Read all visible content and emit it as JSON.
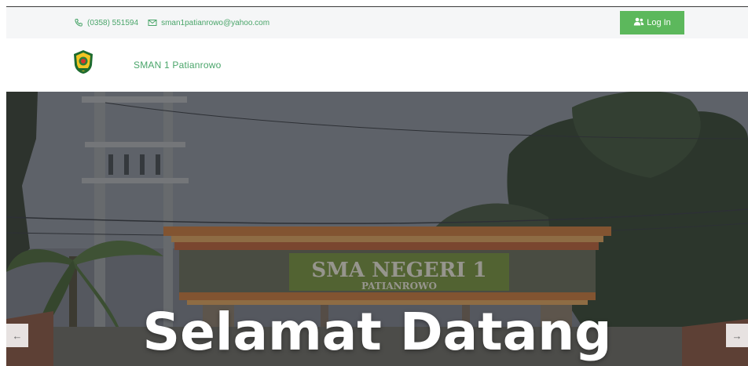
{
  "topbar": {
    "phone": "(0358) 551594",
    "email": "sman1patianrowo@yahoo.com",
    "login_label": "Log In"
  },
  "header": {
    "site_title": "SMAN 1 Patianrowo"
  },
  "hero": {
    "title": "Selamat Datang",
    "sign_line1": "SMA NEGERI 1",
    "sign_line2": "PATIANROWO",
    "prev_arrow": "←",
    "next_arrow": "→"
  },
  "colors": {
    "accent_green": "#4aa56a",
    "button_green": "#5cb85c",
    "topbar_bg": "#f5f6f7"
  },
  "icons": {
    "phone": "phone-icon",
    "email": "mail-icon",
    "login": "users-icon",
    "logo": "school-logo"
  }
}
